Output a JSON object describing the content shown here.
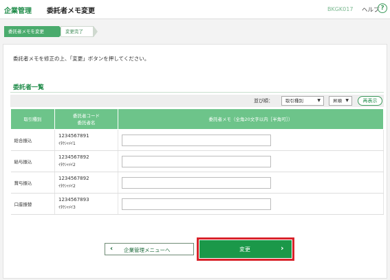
{
  "header": {
    "section_title": "企業管理",
    "page_title": "委託者メモ変更",
    "screen_code": "BKGK017",
    "help_label": "ヘルプ",
    "help_icon": "?"
  },
  "steps": [
    {
      "label": "委託者メモを変更",
      "active": true
    },
    {
      "label": "変更完了",
      "active": false
    }
  ],
  "instruction": "委託者メモを修正の上、「変更」ボタンを押してください。",
  "section": {
    "title": "委託者一覧",
    "sort_label": "並び順：",
    "sort_field": "取引種別",
    "sort_order": "昇順",
    "refresh_label": "再表示"
  },
  "table": {
    "headers": {
      "type": "取引種別",
      "code_line1": "委託者コード",
      "code_line2": "委託者名",
      "memo": "委託者メモ（全角20文字以内［半角可］）"
    },
    "rows": [
      {
        "type": "総合振込",
        "code": "1234567891",
        "name": "ｲﾀｸｼｬﾒｲ1",
        "memo": ""
      },
      {
        "type": "給与振込",
        "code": "1234567892",
        "name": "ｲﾀｸｼｬﾒｲ2",
        "memo": ""
      },
      {
        "type": "賞与振込",
        "code": "1234567892",
        "name": "ｲﾀｸｼｬﾒｲ2",
        "memo": ""
      },
      {
        "type": "口座振替",
        "code": "1234567893",
        "name": "ｲﾀｸｼｬﾒｲ3",
        "memo": ""
      }
    ]
  },
  "buttons": {
    "back_label": "企業管理メニューへ",
    "change_label": "変更"
  },
  "colors": {
    "brand_green": "#1e8b48",
    "table_header": "#6dc48a",
    "primary_button": "#1b9849",
    "highlight_red": "#d8222a"
  }
}
